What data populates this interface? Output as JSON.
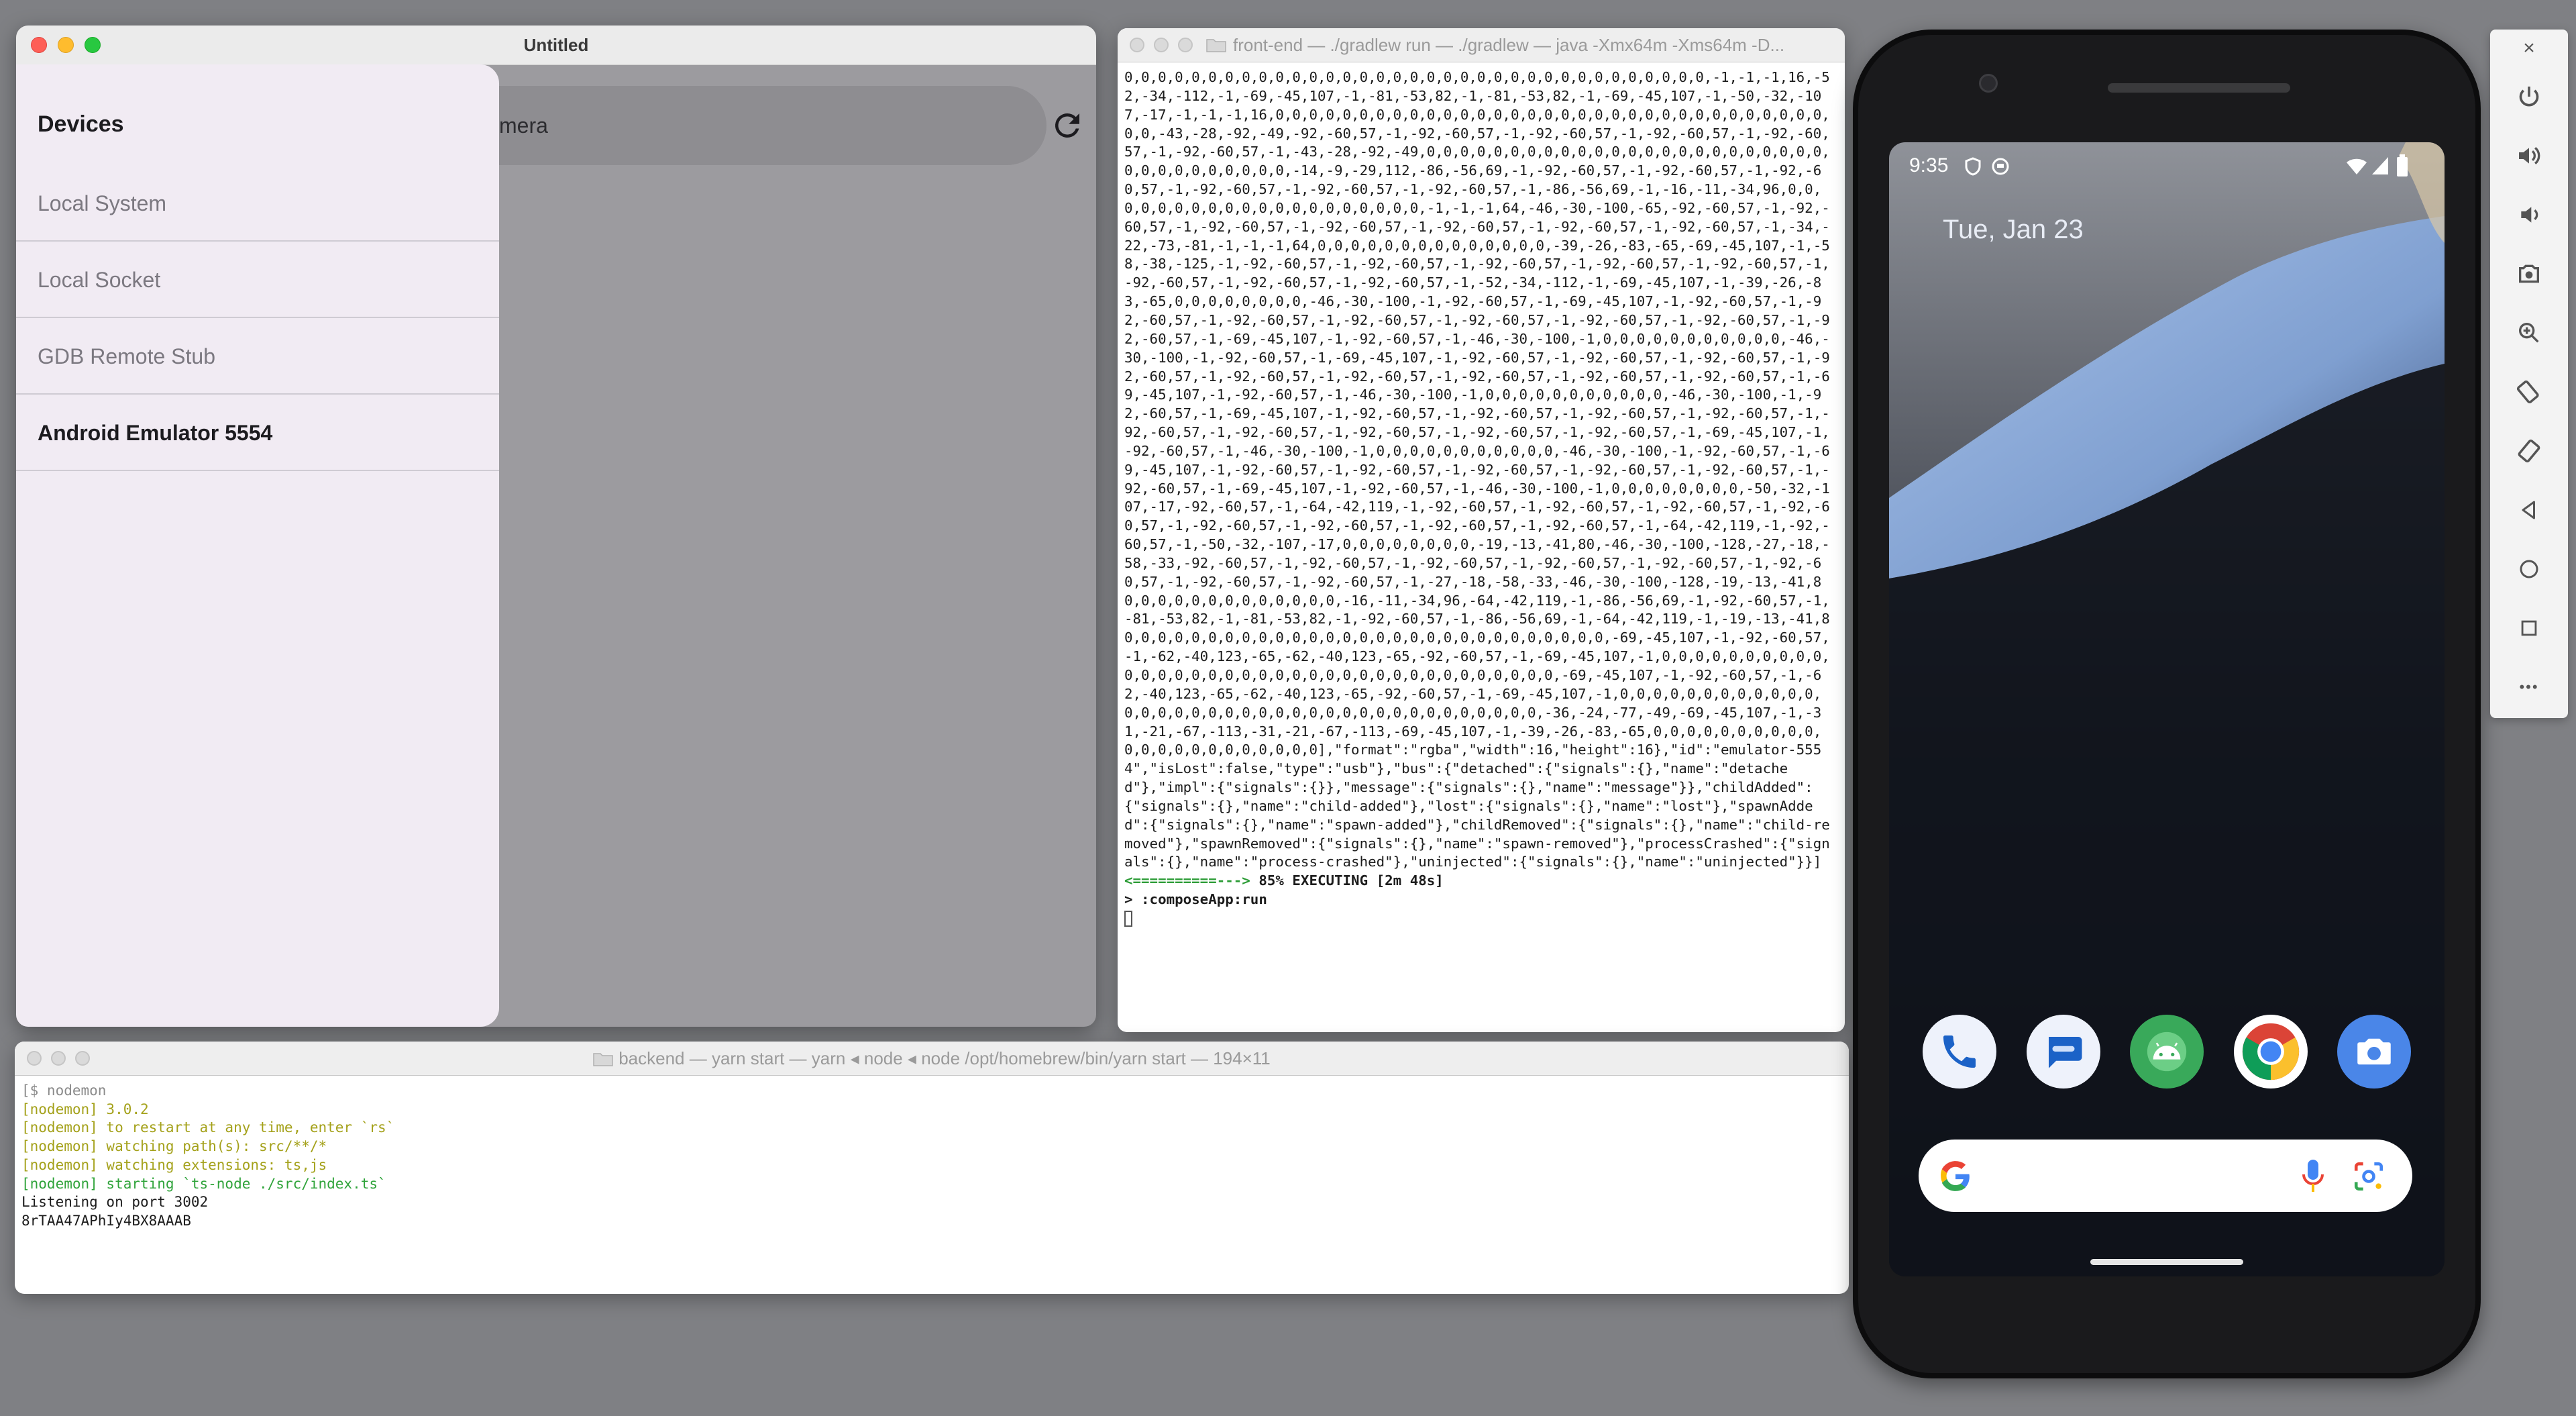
{
  "compose_window": {
    "title": "Untitled",
    "search_text": "mera",
    "drawer": {
      "title": "Devices",
      "items": [
        {
          "label": "Local System"
        },
        {
          "label": "Local Socket"
        },
        {
          "label": "GDB Remote Stub"
        },
        {
          "label": "Android Emulator 5554"
        }
      ]
    }
  },
  "frontend_terminal": {
    "title": "front-end — ./gradlew run — ./gradlew — java -Xmx64m -Xms64m -D...",
    "output": "0,0,0,0,0,0,0,0,0,0,0,0,0,0,0,0,0,0,0,0,0,0,0,0,0,0,0,0,0,0,0,0,0,0,0,-1,-1,-1,16,-52,-34,-112,-1,-69,-45,107,-1,-81,-53,82,-1,-81,-53,82,-1,-69,-45,107,-1,-50,-32,-107,-17,-1,-1,-1,16,0,0,0,0,0,0,0,0,0,0,0,0,0,0,0,0,0,0,0,0,0,0,0,0,0,0,0,0,0,0,0,0,0,0,0,-43,-28,-92,-49,-92,-60,57,-1,-92,-60,57,-1,-92,-60,57,-1,-92,-60,57,-1,-92,-60,57,-1,-92,-60,57,-1,-43,-28,-92,-49,0,0,0,0,0,0,0,0,0,0,0,0,0,0,0,0,0,0,0,0,0,0,0,0,0,0,0,0,0,0,0,0,0,0,-14,-9,-29,112,-86,-56,69,-1,-92,-60,57,-1,-92,-60,57,-1,-92,-60,57,-1,-92,-60,57,-1,-92,-60,57,-1,-92,-60,57,-1,-86,-56,69,-1,-16,-11,-34,96,0,0,0,0,0,0,0,0,0,0,0,0,0,0,0,0,0,0,0,0,-1,-1,-1,64,-46,-30,-100,-65,-92,-60,57,-1,-92,-60,57,-1,-92,-60,57,-1,-92,-60,57,-1,-92,-60,57,-1,-92,-60,57,-1,-92,-60,57,-1,-34,-22,-73,-81,-1,-1,-1,64,0,0,0,0,0,0,0,0,0,0,0,0,0,0,-39,-26,-83,-65,-69,-45,107,-1,-58,-38,-125,-1,-92,-60,57,-1,-92,-60,57,-1,-92,-60,57,-1,-92,-60,57,-1,-92,-60,57,-1,-92,-60,57,-1,-92,-60,57,-1,-92,-60,57,-1,-52,-34,-112,-1,-69,-45,107,-1,-39,-26,-83,-65,0,0,0,0,0,0,0,0,-46,-30,-100,-1,-92,-60,57,-1,-69,-45,107,-1,-92,-60,57,-1,-92,-60,57,-1,-92,-60,57,-1,-92,-60,57,-1,-92,-60,57,-1,-92,-60,57,-1,-92,-60,57,-1,-92,-60,57,-1,-69,-45,107,-1,-92,-60,57,-1,-46,-30,-100,-1,0,0,0,0,0,0,0,0,0,0,0,-46,-30,-100,-1,-92,-60,57,-1,-69,-45,107,-1,-92,-60,57,-1,-92,-60,57,-1,-92,-60,57,-1,-92,-60,57,-1,-92,-60,57,-1,-92,-60,57,-1,-92,-60,57,-1,-92,-60,57,-1,-92,-60,57,-1,-69,-45,107,-1,-92,-60,57,-1,-46,-30,-100,-1,0,0,0,0,0,0,0,0,0,0,0,-46,-30,-100,-1,-92,-60,57,-1,-69,-45,107,-1,-92,-60,57,-1,-92,-60,57,-1,-92,-60,57,-1,-92,-60,57,-1,-92,-60,57,-1,-92,-60,57,-1,-92,-60,57,-1,-92,-60,57,-1,-92,-60,57,-1,-69,-45,107,-1,-92,-60,57,-1,-46,-30,-100,-1,0,0,0,0,0,0,0,0,0,0,0,-46,-30,-100,-1,-92,-60,57,-1,-69,-45,107,-1,-92,-60,57,-1,-92,-60,57,-1,-92,-60,57,-1,-92,-60,57,-1,-92,-60,57,-1,-92,-60,57,-1,-69,-45,107,-1,-92,-60,57,-1,-46,-30,-100,-1,0,0,0,0,0,0,0,0,-50,-32,-107,-17,-92,-60,57,-1,-64,-42,119,-1,-92,-60,57,-1,-92,-60,57,-1,-92,-60,57,-1,-92,-60,57,-1,-92,-60,57,-1,-92,-60,57,-1,-92,-60,57,-1,-92,-60,57,-1,-64,-42,119,-1,-92,-60,57,-1,-50,-32,-107,-17,0,0,0,0,0,0,0,0,-19,-13,-41,80,-46,-30,-100,-128,-27,-18,-58,-33,-92,-60,57,-1,-92,-60,57,-1,-92,-60,57,-1,-92,-60,57,-1,-92,-60,57,-1,-92,-60,57,-1,-92,-60,57,-1,-92,-60,57,-1,-27,-18,-58,-33,-46,-30,-100,-128,-19,-13,-41,80,0,0,0,0,0,0,0,0,0,0,0,0,-16,-11,-34,96,-64,-42,119,-1,-86,-56,69,-1,-92,-60,57,-1,-81,-53,82,-1,-81,-53,82,-1,-92,-60,57,-1,-86,-56,69,-1,-64,-42,119,-1,-19,-13,-41,80,0,0,0,0,0,0,0,0,0,0,0,0,0,0,0,0,0,0,0,0,0,0,0,0,0,0,0,0,-69,-45,107,-1,-92,-60,57,-1,-62,-40,123,-65,-62,-40,123,-65,-92,-60,57,-1,-69,-45,107,-1,0,0,0,0,0,0,0,0,0,0,0,0,0,0,0,0,0,0,0,0,0,0,0,0,0,0,0,0,0,0,0,0,0,0,0,0,-69,-45,107,-1,-92,-60,57,-1,-62,-40,123,-65,-62,-40,123,-65,-92,-60,57,-1,-69,-45,107,-1,0,0,0,0,0,0,0,0,0,0,0,0,0,0,0,0,0,0,0,0,0,0,0,0,0,0,0,0,0,0,0,0,0,0,0,0,0,-36,-24,-77,-49,-69,-45,107,-1,-31,-21,-67,-113,-31,-21,-67,-113,-69,-45,107,-1,-39,-26,-83,-65,0,0,0,0,0,0,0,0,0,0,0,0,0,0,0,0,0,0,0,0,0,0],\"format\":\"rgba\",\"width\":16,\"height\":16},\"id\":\"emulator-5554\",\"isLost\":false,\"type\":\"usb\"},\"bus\":{\"detached\":{\"signals\":{},\"name\":\"detached\"},\"impl\":{\"signals\":{}},\"message\":{\"signals\":{},\"name\":\"message\"}},\"childAdded\":{\"signals\":{},\"name\":\"child-added\"},\"lost\":{\"signals\":{},\"name\":\"lost\"},\"spawnAdded\":{\"signals\":{},\"name\":\"spawn-added\"},\"childRemoved\":{\"signals\":{},\"name\":\"child-removed\"},\"spawnRemoved\":{\"signals\":{},\"name\":\"spawn-removed\"},\"processCrashed\":{\"signals\":{},\"name\":\"process-crashed\"},\"uninjected\":{\"signals\":{},\"name\":\"uninjected\"}}]",
    "progress_bar": "<==========--->",
    "progress_text": " 85% EXECUTING [2m 48s]",
    "task_line": "> :composeApp:run"
  },
  "backend_terminal": {
    "title": "backend — yarn start — yarn ◂ node ◂ node /opt/homebrew/bin/yarn start — 194×11",
    "lines": {
      "l1": "[$ nodemon",
      "l2": "[nodemon] 3.0.2",
      "l3": "[nodemon] to restart at any time, enter `rs`",
      "l4": "[nodemon] watching path(s): src/**/*",
      "l5": "[nodemon] watching extensions: ts,js",
      "l6": "[nodemon] starting `ts-node ./src/index.ts`",
      "l7": "Listening on port 3002",
      "l8": "8rTAA47APhIy4BX8AAAB"
    }
  },
  "phone": {
    "time": "9:35",
    "date": "Tue, Jan 23",
    "dock_apps": [
      "phone-icon",
      "messages-icon",
      "android-app-icon",
      "chrome-icon",
      "camera-icon"
    ]
  },
  "emulator_toolbar": {
    "tools": [
      "close-icon",
      "power-icon",
      "volume-up-icon",
      "volume-down-icon",
      "screenshot-icon",
      "zoom-icon",
      "rotate-left-icon",
      "rotate-right-icon",
      "back-icon",
      "home-icon",
      "overview-icon",
      "more-icon"
    ],
    "close_glyph": "×",
    "more_glyph": "•••"
  },
  "colors": {
    "desktop": "#7f8084",
    "terminal_green": "#2e9d38",
    "nodemon_yellow": "#a4a11a",
    "nodemon_green": "#2fa33a"
  }
}
